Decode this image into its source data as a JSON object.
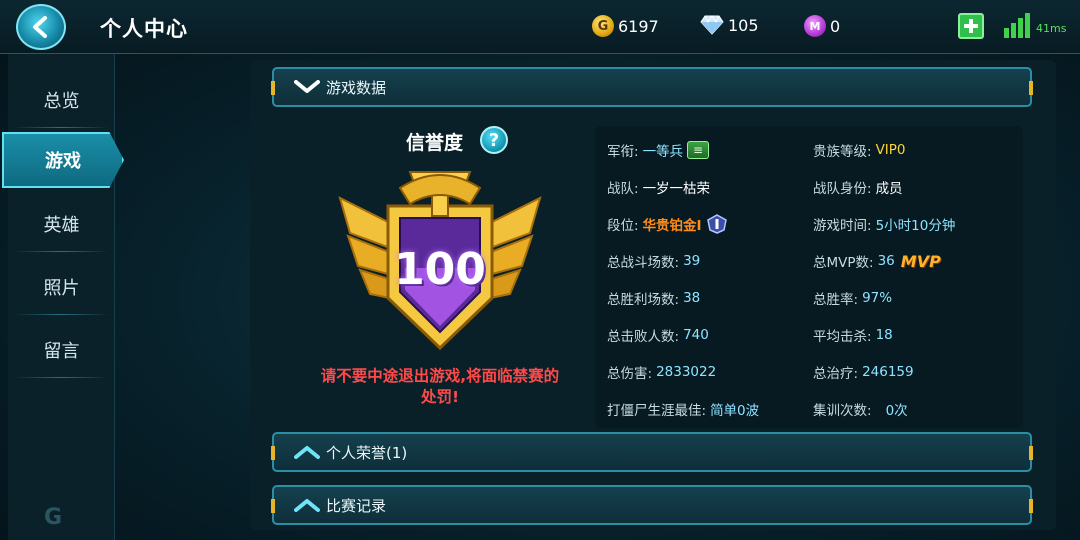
{
  "header": {
    "title": "个人中心",
    "gold": "6197",
    "diamond": "105",
    "m_coin": "0",
    "m_coin_symbol": "M",
    "gold_symbol": "G",
    "ping": "41ms"
  },
  "sidebar": {
    "items": [
      {
        "label": "总览",
        "active": false
      },
      {
        "label": "游戏",
        "active": true
      },
      {
        "label": "英雄",
        "active": false
      },
      {
        "label": "照片",
        "active": false
      },
      {
        "label": "留言",
        "active": false
      }
    ],
    "logo": "G"
  },
  "sections": {
    "game_data": "游戏数据",
    "honors": "个人荣誉(1)",
    "match_records": "比赛记录"
  },
  "credit": {
    "title": "信誉度",
    "help": "?",
    "score": "100",
    "warning": "请不要中途退出游戏,将面临禁赛的处罚!"
  },
  "stats": {
    "rank_label": "军衔:",
    "rank_value": "一等兵",
    "rank_badge": "≡",
    "noble_label": "贵族等级:",
    "noble_value": "VIP0",
    "team_label": "战队:",
    "team_value": "一岁一枯荣",
    "team_role_label": "战队身份:",
    "team_role_value": "成员",
    "tier_label": "段位:",
    "tier_value": "华贵铂金I",
    "play_time_label": "游戏时间:",
    "play_time_value": "5小时10分钟",
    "total_matches_label": "总战斗场数:",
    "total_matches_value": "39",
    "total_mvp_label": "总MVP数:",
    "total_mvp_value": "36",
    "mvp_tag": "MVP",
    "total_wins_label": "总胜利场数:",
    "total_wins_value": "38",
    "win_rate_label": "总胜率:",
    "win_rate_value": "97%",
    "total_kills_label": "总击败人数:",
    "total_kills_value": "740",
    "avg_kills_label": "平均击杀:",
    "avg_kills_value": "18",
    "total_damage_label": "总伤害:",
    "total_damage_value": "2833022",
    "total_heal_label": "总治疗:",
    "total_heal_value": "246159",
    "zombie_best_label": "打僵尸生涯最佳:",
    "zombie_best_value": "简单0波",
    "training_label": "集训次数:",
    "training_value": "0次"
  },
  "colors": {
    "accent": "#2d8ea3",
    "active_tab": "#1a8ea8",
    "warning": "#ff4a4a",
    "gold": "#ffd23a",
    "tier": "#ff8c1a"
  }
}
